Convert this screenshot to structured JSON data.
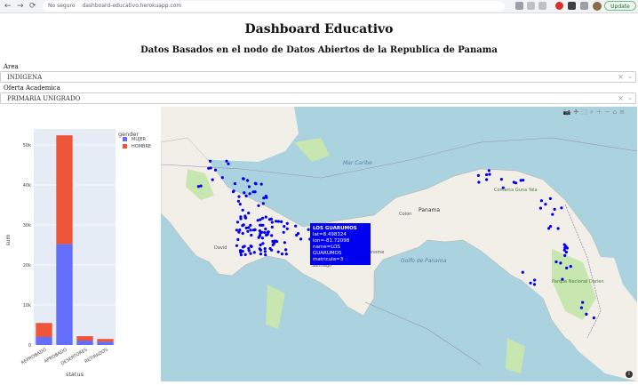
{
  "browser": {
    "back": "←",
    "forward": "→",
    "reload": "⟳",
    "security_label": "No seguro",
    "url": "dashboard-educativo.herokuapp.com",
    "update_label": "Update"
  },
  "header": {
    "title": "Dashboard Educativo",
    "subtitle": "Datos Basados en el nodo de Datos Abiertos de la Republica de Panama"
  },
  "filters": {
    "area_label": "Area",
    "area_value": "INDIGENA",
    "oferta_label": "Oferta Academica",
    "oferta_value": "PRIMARIA UNIGRADO",
    "clear_symbol": "×",
    "caret_symbol": "⌄"
  },
  "chart_data": {
    "type": "bar",
    "stacked": true,
    "categories": [
      "REPROBADO",
      "APROBADO",
      "DESERTORES",
      "RETIRADOS"
    ],
    "series": [
      {
        "name": "MUJER",
        "color": "#636efa",
        "values": [
          2000,
          25200,
          1100,
          800
        ]
      },
      {
        "name": "HOMBRE",
        "color": "#ef553b",
        "values": [
          3500,
          27200,
          1100,
          700
        ]
      }
    ],
    "ylim": [
      0,
      54000
    ],
    "y_ticks": [
      0,
      10000,
      20000,
      30000,
      40000,
      50000
    ],
    "y_tick_labels": [
      "0",
      "10k",
      "20k",
      "30k",
      "40k",
      "50k"
    ],
    "xlabel": "status",
    "ylabel": "sum",
    "legend_title": "gender",
    "legend_position": "top-right"
  },
  "map": {
    "labels": {
      "atlantic": "Mar Caribe",
      "panama": "Panama",
      "colon": "Colon",
      "penonome": "Penonome",
      "santiago": "Santiago",
      "david": "David",
      "darien": "Parque Nacional Darien",
      "gulf": "Golfo de Panama",
      "sanblas": "Comarca Guna Yala"
    },
    "tooltip": {
      "title": "LOS GUARUMOS",
      "lat": "lat=8.498324",
      "lon": "lon=-81.72098",
      "name": "name=LOS GUARUMOS",
      "extra": "matricula=3"
    },
    "modebar": [
      "📷",
      "✚",
      "⬚",
      "⌕",
      "＋",
      "−",
      "⌂",
      "≡"
    ],
    "info_icon": "i",
    "marker_color": "#0000ee"
  }
}
